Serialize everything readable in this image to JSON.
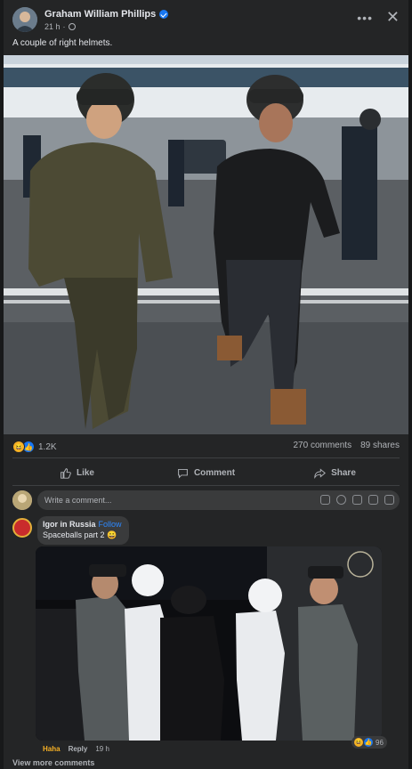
{
  "post": {
    "author": "Graham William Phillips",
    "time": "21 h",
    "caption": "A couple of right helmets.",
    "more_icon": "more-horizontal-icon",
    "close_icon": "close-icon"
  },
  "stats": {
    "reaction_count": "1.2K",
    "comments": "270 comments",
    "shares": "89 shares"
  },
  "actions": {
    "like": "Like",
    "comment": "Comment",
    "share": "Share"
  },
  "composer": {
    "placeholder": "Write a comment..."
  },
  "comment": {
    "author": "Igor in Russia",
    "follow": "Follow",
    "text": "Spaceballs part 2 😀",
    "reaction_count": "96",
    "react_label": "Haha",
    "reply_label": "Reply",
    "time": "19 h"
  },
  "footer": {
    "view_more": "View more comments"
  },
  "colors": {
    "background": "#18191a",
    "card": "#242526",
    "accent": "#1877f2",
    "haha": "#f7b125"
  }
}
